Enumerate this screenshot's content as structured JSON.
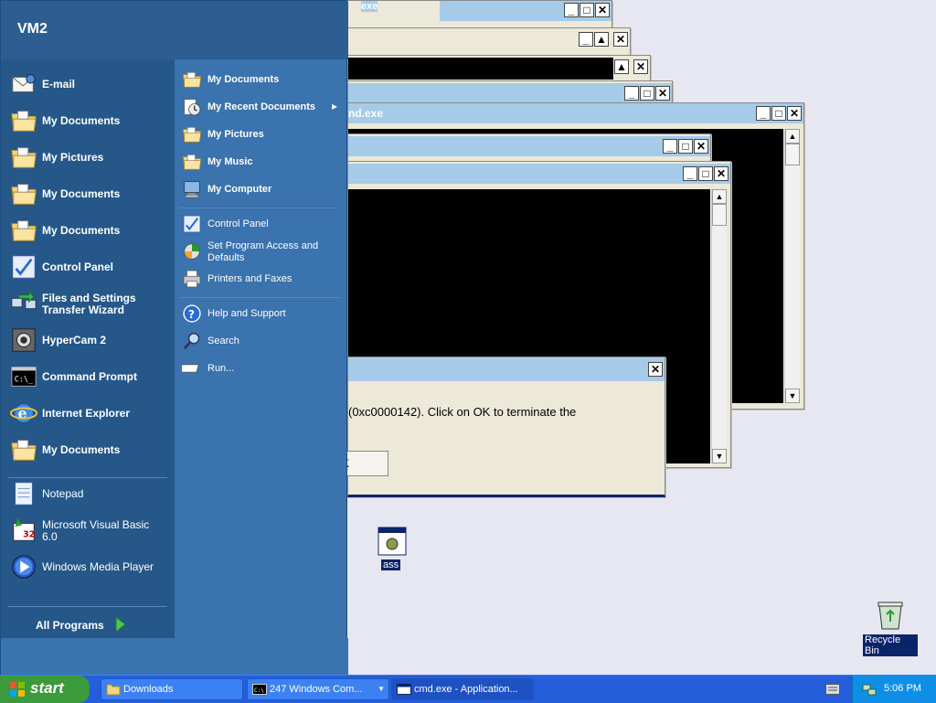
{
  "start_menu": {
    "user": "VM2",
    "left_items": [
      {
        "label": "E-mail",
        "bold": true,
        "icon": "email-icon"
      },
      {
        "label": "My Documents",
        "bold": true,
        "icon": "folder-icon"
      },
      {
        "label": "My Pictures",
        "bold": true,
        "icon": "folder-icon"
      },
      {
        "label": "My Documents",
        "bold": true,
        "icon": "folder-icon"
      },
      {
        "label": "My Documents",
        "bold": true,
        "icon": "folder-icon"
      },
      {
        "label": "Control Panel",
        "bold": true,
        "icon": "control-panel-icon"
      },
      {
        "label": "Files and Settings Transfer Wizard",
        "bold": true,
        "icon": "transfer-wizard-icon"
      },
      {
        "label": "HyperCam 2",
        "bold": true,
        "icon": "hypercam-icon"
      },
      {
        "label": "Command Prompt",
        "bold": true,
        "icon": "command-prompt-icon"
      },
      {
        "label": "Internet Explorer",
        "bold": true,
        "icon": "internet-explorer-icon"
      },
      {
        "label": "My Documents",
        "bold": true,
        "icon": "folder-icon"
      },
      {
        "label": "Notepad",
        "bold": false,
        "icon": "notepad-icon"
      },
      {
        "label": "Microsoft Visual Basic 6.0",
        "bold": false,
        "icon": "visual-basic-icon"
      },
      {
        "label": "Windows Media Player",
        "bold": false,
        "icon": "media-player-icon"
      }
    ],
    "all_programs": "All Programs",
    "right_items": [
      {
        "label": "My Documents",
        "bold": true,
        "icon": "folder-icon"
      },
      {
        "label": "My Recent Documents",
        "bold": true,
        "icon": "recent-documents-icon"
      },
      {
        "label": "My Pictures",
        "bold": true,
        "icon": "folder-icon"
      },
      {
        "label": "My Music",
        "bold": true,
        "icon": "folder-icon"
      },
      {
        "label": "My Computer",
        "bold": true,
        "icon": "computer-icon"
      },
      {
        "label": "Control Panel",
        "bold": false,
        "icon": "control-panel-icon"
      },
      {
        "label": "Set Program Access and Defaults",
        "bold": false,
        "icon": "program-access-icon"
      },
      {
        "label": "Printers and Faxes",
        "bold": false,
        "icon": "printer-icon"
      },
      {
        "label": "Help and Support",
        "bold": false,
        "icon": "help-icon"
      },
      {
        "label": "Search",
        "bold": false,
        "icon": "search-icon"
      },
      {
        "label": "Run...",
        "bold": false,
        "icon": "run-icon"
      }
    ]
  },
  "windows": {
    "back_title_fragment": "nd.exe",
    "top_fragment": "exe",
    "error_text": "(0xc0000142). Click on OK to terminate the",
    "ok_fragment": "K"
  },
  "desktop": {
    "ass_label": "ass",
    "recycle_label": "Recycle Bin"
  },
  "taskbar": {
    "start": "start",
    "tasks": [
      {
        "label": "Downloads"
      },
      {
        "label": "247 Windows Com...",
        "count": "247"
      },
      {
        "label": "cmd.exe - Application..."
      }
    ],
    "clock": "5:06 PM"
  },
  "colors": {
    "taskbar": "#245edb",
    "start_button": "#3b9a3c",
    "menu_left": "#255789",
    "menu_right": "#3a73ad"
  }
}
